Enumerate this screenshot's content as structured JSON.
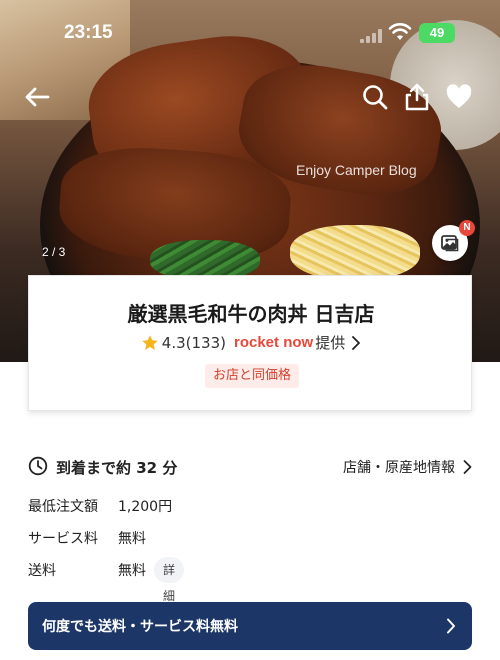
{
  "status_bar": {
    "time": "23:15",
    "battery": "49"
  },
  "hero": {
    "page_indicator": "2 / 3",
    "watermark": "Enjoy Camper Blog",
    "gallery_badge": "N"
  },
  "store": {
    "name": "厳選黒毛和牛の肉丼 日吉店",
    "rating": "4.3",
    "review_count": "(133)",
    "provider_brand": "rocket now",
    "provider_suffix": "提供",
    "price_badge": "お店と同価格"
  },
  "delivery": {
    "eta": "到着まで約 32 分",
    "origin_link": "店舗・原産地情報"
  },
  "fees": {
    "min_order_label": "最低注文額",
    "min_order_value": "1,200円",
    "service_fee_label": "サービス料",
    "service_fee_value": "無料",
    "delivery_fee_label": "送料",
    "delivery_fee_value": "無料",
    "detail_label": "詳細"
  },
  "promo": {
    "text": "何度でも送料・サービス料無料"
  },
  "colors": {
    "accent_red": "#e8483a",
    "promo_navy": "#1b3667",
    "badge_bg": "#fdecea"
  }
}
